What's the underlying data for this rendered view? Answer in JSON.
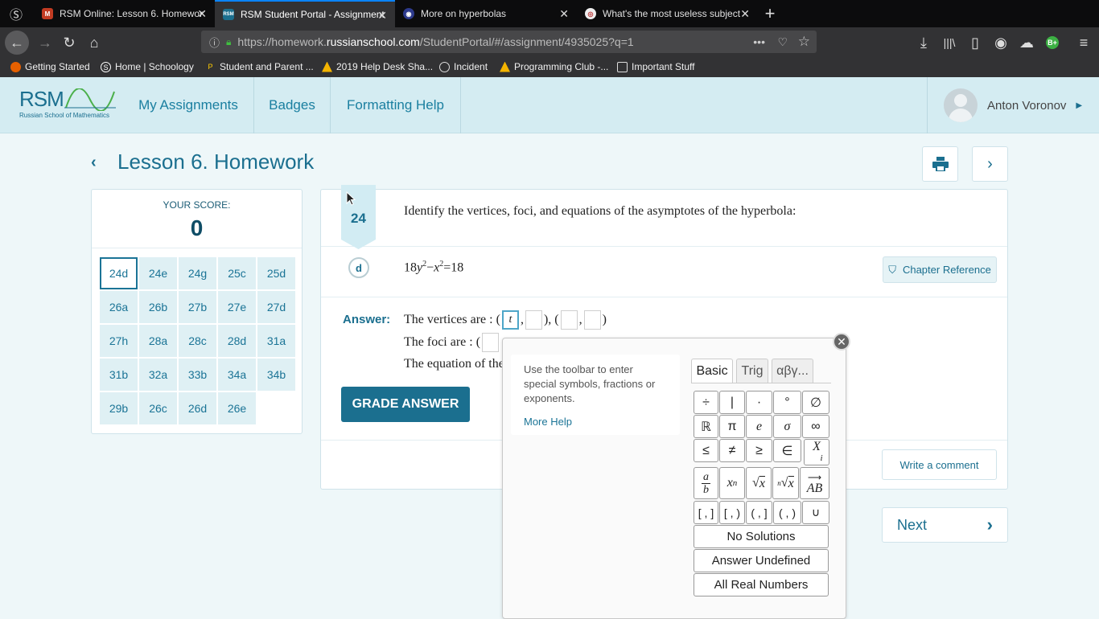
{
  "browser": {
    "tabs": [
      {
        "title": "RSM Online: Lesson 6. Homework",
        "close": "✕",
        "fav_bg": "#c23b22",
        "fav_text": "M"
      },
      {
        "title": "RSM Student Portal - Assignment",
        "close": "✕",
        "fav_bg": "#1b6f8f",
        "fav_text": "RSM"
      },
      {
        "title": "More on hyperbolas",
        "close": "✕",
        "fav_bg": "#2d3a8c",
        "fav_text": "◉"
      },
      {
        "title": "What's the most useless subject",
        "close": "✕",
        "fav_bg": "#b33",
        "fav_text": "◎"
      }
    ],
    "new_tab": "+",
    "url_prefix": "https://homework.",
    "url_host": "russianschool.com",
    "url_path": "/StudentPortal/#/assignment/4935025?q=1",
    "bookmarks": [
      "Getting Started",
      "Home | Schoology",
      "Student and Parent ...",
      "2019 Help Desk Sha...",
      "Incident",
      "Programming Club -...",
      "Important Stuff"
    ],
    "ext_badge": "B+"
  },
  "site": {
    "logo_text": "RSM",
    "logo_sub": "Russian School of Mathematics",
    "nav": [
      "My Assignments",
      "Badges",
      "Formatting Help"
    ],
    "user_name": "Anton Voronov"
  },
  "lesson": {
    "title": "Lesson 6. Homework"
  },
  "score": {
    "label": "YOUR SCORE:",
    "value": "0",
    "questions": [
      "24d",
      "24e",
      "24g",
      "25c",
      "25d",
      "26a",
      "26b",
      "27b",
      "27e",
      "27d",
      "27h",
      "28a",
      "28c",
      "28d",
      "31a",
      "31b",
      "32a",
      "33b",
      "34a",
      "34b",
      "29b",
      "26c",
      "26d",
      "26e"
    ],
    "selected": "24d"
  },
  "question": {
    "number": "24",
    "text": "Identify the vertices, foci, and equations of the asymptotes of the hyperbola:",
    "part": "d",
    "eq_a": "18",
    "eq_y": "y",
    "eq_exp1": "2",
    "eq_minus": "−",
    "eq_x": "x",
    "eq_exp2": "2",
    "eq_rest": "=18",
    "chapter_ref": "Chapter Reference"
  },
  "answer": {
    "label": "Answer:",
    "vertices_label": "The vertices are : (",
    "foci_label": "The foci are : (",
    "asymptote_label": "The equation of the",
    "grade_button": "GRADE ANSWER",
    "comment_button": "Write a comment",
    "next_button": "Next",
    "focused_value": "t"
  },
  "toolbar": {
    "help_text": "Use the toolbar to enter special symbols, fractions or exponents.",
    "more_help": "More Help",
    "tabs": [
      "Basic",
      "Trig",
      "αβγ..."
    ],
    "keys_row1": [
      "÷",
      "|",
      "·",
      "°",
      "∅"
    ],
    "keys_row2": [
      "ℝ",
      "π",
      "e",
      "σ",
      "∞"
    ],
    "keys_row3": [
      "≤",
      "≠",
      "≥",
      "∈"
    ],
    "keys_row5": [
      "[ , ]",
      "[ , )",
      "( , ]",
      "( , )",
      "∪"
    ],
    "no_solutions": "No Solutions",
    "undefined": "Answer Undefined",
    "all_reals": "All Real Numbers"
  },
  "colors": {
    "accent": "#1b6f8f",
    "header_bg": "#d4ecf2",
    "page_bg": "#eef7f9"
  }
}
